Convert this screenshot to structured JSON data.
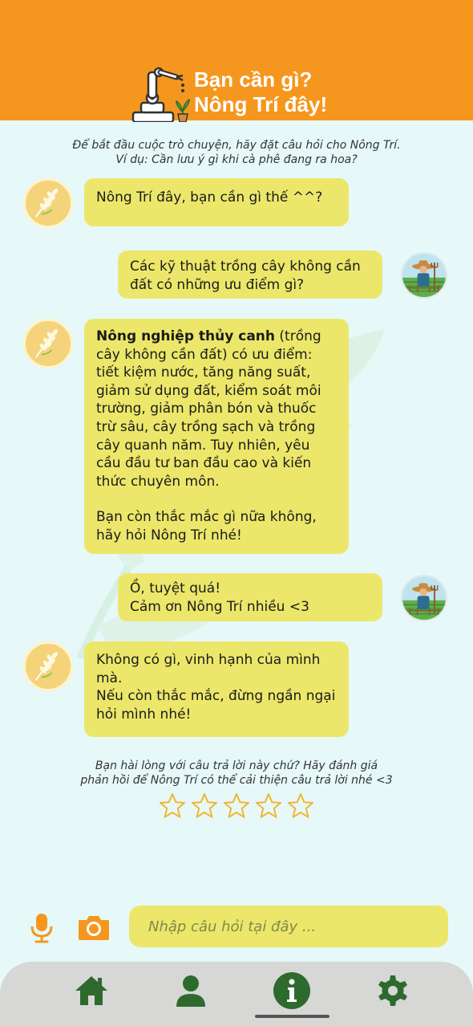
{
  "header": {
    "title_line1": "Bạn cần gì?",
    "title_line2": "Nông Trí đây!",
    "bg_color": "#f5971e",
    "icon": "robot-arm-icon"
  },
  "intro": {
    "line1": "Để bắt đầu cuộc trò chuyện, hãy đặt câu hỏi cho Nông Trí.",
    "line2": "Ví dụ: Cần lưu ý gì khi cà phê đang ra hoa?"
  },
  "messages": [
    {
      "sender": "bot",
      "avatar": "rice-plant-icon",
      "text": "Nông Trí đây, bạn cần gì thế ^^?"
    },
    {
      "sender": "user",
      "avatar": "farmer-avatar",
      "text": "Các kỹ thuật trồng cây không cần đất có những ưu điểm gì?"
    },
    {
      "sender": "bot",
      "avatar": "rice-plant-icon",
      "bold": "Nông nghiệp thủy canh",
      "text": " (trồng cây không cần đất) có ưu điểm: tiết kiệm nước, tăng năng suất, giảm sử dụng đất, kiểm soát môi trường, giảm phân bón và thuốc trừ sâu, cây trồng sạch và trồng cây quanh năm. Tuy nhiên, yêu cầu đầu tư ban đầu cao và kiến thức chuyên môn.",
      "text2": "Bạn còn thắc mắc gì nữa không, hãy hỏi Nông Trí nhé!"
    },
    {
      "sender": "user",
      "avatar": "farmer-avatar",
      "line1": "Ồ, tuyệt quá!",
      "line2": "Cảm ơn Nông Trí nhiều <3"
    },
    {
      "sender": "bot",
      "avatar": "rice-plant-icon",
      "line1": "Không có gì, vinh hạnh của mình mà.",
      "line2": "Nếu còn thắc mắc, đừng ngần ngại hỏi mình nhé!"
    }
  ],
  "rating": {
    "line1": "Bạn hài lòng với câu trả lời này chứ? Hãy đánh giá",
    "line2": "phản hồi để Nông Trí có thể cải thiện câu trả lời nhé <3",
    "stars_total": 5,
    "stars_filled": 0,
    "star_color": "#f2b632"
  },
  "composer": {
    "placeholder": "Nhập câu hỏi tại đây ...",
    "mic_icon": "microphone-icon",
    "camera_icon": "camera-icon",
    "accent": "#f5971e"
  },
  "nav": {
    "items": [
      "home-icon",
      "profile-icon",
      "info-icon",
      "settings-icon"
    ],
    "active": "info-icon",
    "color": "#2e6a2e"
  }
}
